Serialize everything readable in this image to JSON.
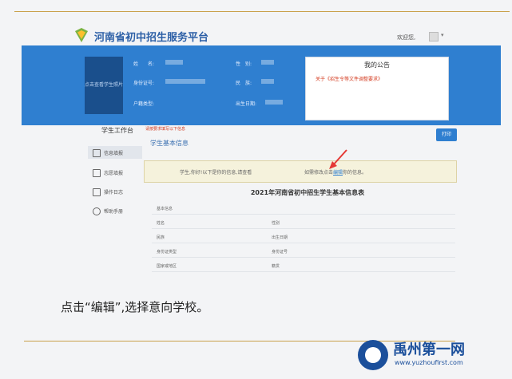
{
  "app": {
    "title": "河南省初中招生服务平台",
    "welcome": "欢迎您,",
    "user_menu_caret": "▾"
  },
  "banner": {
    "avatar_text": "点击查看学生照片",
    "fields": [
      {
        "label": "姓　　名:"
      },
      {
        "label": "身份证号:"
      },
      {
        "label": "户籍类型:"
      },
      {
        "label": "性　别:"
      },
      {
        "label": "民　族:"
      },
      {
        "label": "出生日期:"
      }
    ],
    "notice": {
      "title": "我的公告",
      "item": "关于《招生令等文件调整要求》"
    }
  },
  "sidebar": {
    "title": "学生工作台",
    "items": [
      {
        "label": "信息填报",
        "icon": "user-icon"
      },
      {
        "label": "志愿填报",
        "icon": "document-icon"
      },
      {
        "label": "操作日志",
        "icon": "log-icon"
      },
      {
        "label": "帮助手册",
        "icon": "info-icon"
      }
    ]
  },
  "main": {
    "warning": "请按要求填写以下信息",
    "section_title": "学生基本信息",
    "print_button": "打印",
    "tip_left": "学生,你好!以下是你的信息,请查看",
    "tip_right_prefix": "如需修改点击",
    "tip_link": "编辑",
    "tip_right_suffix": "你的信息。",
    "table_title": "2021年河南省初中招生学生基本信息表",
    "table": {
      "section": "基本信息",
      "rows": [
        [
          "姓名",
          "性别"
        ],
        [
          "民族",
          "出生日期"
        ],
        [
          "身份证类型",
          "身份证号"
        ],
        [
          "国家或地区",
          "籍贯"
        ]
      ]
    }
  },
  "caption": "点击“编辑”,选择意向学校。",
  "watermark": {
    "title": "禹州第一网",
    "url": "www.yuzhoufirst.com"
  },
  "colors": {
    "brand_blue": "#2f7fd0",
    "accent_red": "#d3381c",
    "watermark_blue": "#1b4f9b"
  }
}
